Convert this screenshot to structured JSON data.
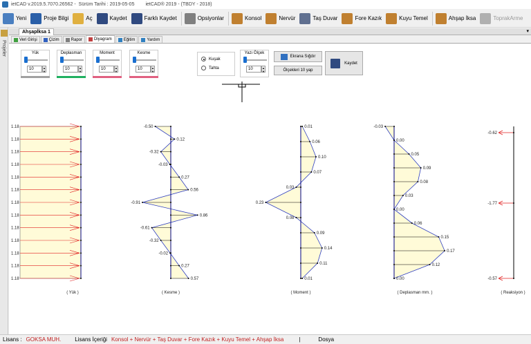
{
  "title": {
    "app_version": "ietCAD v.2019.5.7070.26562 -",
    "release_date": "Sürüm Tarihi : 2019-05-05",
    "product": "ietCAD® 2019 - (TBDY - 2018)"
  },
  "toolbar": [
    {
      "label": "Yeni",
      "icon": "new-file-icon",
      "color": "#4a7fc0"
    },
    {
      "label": "Proje Bilgi",
      "icon": "info-icon",
      "color": "#2a5fa8"
    },
    {
      "label": "Aç",
      "icon": "open-folder-icon",
      "color": "#e0b040"
    },
    {
      "label": "Kaydet",
      "icon": "save-icon",
      "color": "#304a80"
    },
    {
      "label": "Farklı Kaydet",
      "icon": "save-as-icon",
      "color": "#304a80"
    },
    {
      "label": "Opsiyonlar",
      "icon": "gear-icon",
      "color": "#808080"
    },
    {
      "label": "Konsol",
      "icon": "cantilever-wall-icon",
      "color": "#c08030"
    },
    {
      "label": "Nervür",
      "icon": "ribbed-wall-icon",
      "color": "#c08030"
    },
    {
      "label": "Taş Duvar",
      "icon": "stone-wall-icon",
      "color": "#607090"
    },
    {
      "label": "Fore Kazık",
      "icon": "bored-pile-icon",
      "color": "#c08030"
    },
    {
      "label": "Kuyu Temel",
      "icon": "well-foundation-icon",
      "color": "#c08030"
    },
    {
      "label": "Ahşap İksa",
      "icon": "timber-shoring-icon",
      "color": "#c08030"
    },
    {
      "label": "ToprakArme",
      "icon": "soil-reinforcement-icon",
      "color": "#b0b0b0",
      "disabled": true
    }
  ],
  "side_panel": {
    "label": "Projeler"
  },
  "doc_tab": {
    "label": "Ahşapİksa 1",
    "chevron": "▾"
  },
  "subtabs": [
    {
      "label": "Veri Girişi",
      "color": "#40a040"
    },
    {
      "label": "Çizim",
      "color": "#3060c0"
    },
    {
      "label": "Rapor",
      "color": "#808080"
    },
    {
      "label": "Diyagram",
      "color": "#c04040",
      "active": true
    },
    {
      "label": "Eğitim",
      "color": "#3080c0"
    },
    {
      "label": "Yardım",
      "color": "#3080c0"
    }
  ],
  "sliders": [
    {
      "label": "Yük",
      "value": "10",
      "level": 0.0,
      "bar_color": "#a0a0a0"
    },
    {
      "label": "Deplasman",
      "value": "10",
      "level": 0.0,
      "bar_color": "#20b060"
    },
    {
      "label": "Moment",
      "value": "10",
      "level": 0.0,
      "bar_color": "#e06080"
    },
    {
      "label": "Kesme",
      "value": "10",
      "level": 0.0,
      "bar_color": "#e06080"
    }
  ],
  "scale": {
    "label": "Yazı Ölçek",
    "value": "10"
  },
  "radio": [
    {
      "label": "Kuşak",
      "checked": true
    },
    {
      "label": "Tahta",
      "checked": false
    }
  ],
  "buttons": {
    "fit": "Ekrana Sığdır",
    "scale10": "Ölçekleri 10 yap",
    "save": "Kaydet"
  },
  "diagram_labels": {
    "load": "( Yük )",
    "shear": "( Kesme )",
    "moment": "( Moment )",
    "displacement": "( Deplasman mm. )",
    "reaction": "( Reaksiyon )"
  },
  "load_labels": [
    "1.18",
    "1.18",
    "1.18",
    "1.18",
    "1.18",
    "1.18",
    "1.18",
    "1.18",
    "1.18",
    "1.18",
    "1.18",
    "1.18",
    "1.18"
  ],
  "shear": [
    {
      "label": "-0.50",
      "v": -0.5
    },
    {
      "label": "0.12",
      "v": 0.12
    },
    {
      "label": "-0.32",
      "v": -0.32
    },
    {
      "label": "-0.03",
      "v": -0.03
    },
    {
      "label": "0.27",
      "v": 0.27
    },
    {
      "label": "0.56",
      "v": 0.56
    },
    {
      "label": "-0.91",
      "v": -0.91
    },
    {
      "label": "0.86",
      "v": 0.86
    },
    {
      "label": "-0.61",
      "v": -0.61
    },
    {
      "label": "-0.32",
      "v": -0.32
    },
    {
      "label": "-0.02",
      "v": -0.02
    },
    {
      "label": "0.27",
      "v": 0.27
    },
    {
      "label": "0.57",
      "v": 0.57
    }
  ],
  "moment": [
    {
      "label": "0.01",
      "v": 0.01
    },
    {
      "label": "0.06",
      "v": 0.06
    },
    {
      "label": "0.10",
      "v": 0.1
    },
    {
      "label": "0.07",
      "v": 0.07
    },
    {
      "label": "0.03",
      "v": -0.03
    },
    {
      "label": "0.23",
      "v": -0.23
    },
    {
      "label": "0.08",
      "v": -0.03
    },
    {
      "label": "0.09",
      "v": 0.09
    },
    {
      "label": "0.14",
      "v": 0.14
    },
    {
      "label": "0.11",
      "v": 0.11
    },
    {
      "label": "0.01",
      "v": 0.01
    }
  ],
  "displacement": [
    {
      "label": "-0.03",
      "v": -0.03
    },
    {
      "label": "0.00",
      "v": 0.0
    },
    {
      "label": "0.05",
      "v": 0.05
    },
    {
      "label": "0.09",
      "v": 0.09
    },
    {
      "label": "0.08",
      "v": 0.08
    },
    {
      "label": "0.03",
      "v": 0.03
    },
    {
      "label": "0.00",
      "v": 0.0
    },
    {
      "label": "0.06",
      "v": 0.06
    },
    {
      "label": "0.15",
      "v": 0.15
    },
    {
      "label": "0.17",
      "v": 0.17
    },
    {
      "label": "0.12",
      "v": 0.12
    },
    {
      "label": "0.00",
      "v": 0.0
    }
  ],
  "reaction": [
    "-0.62",
    "-1.77",
    "-0.57"
  ],
  "status": {
    "license_label": "Lisans :",
    "license_value": "GOKSA MUH.",
    "content_label": "Lisans İçeriği",
    "content_value": "Konsol + Nervür + Taş Duvar + Fore Kazık + Kuyu Temel + Ahşap İksa",
    "sep": "|",
    "unit": "Dosya"
  },
  "colors": {
    "fill": "#fffbd8",
    "load_arrow": "#e02020",
    "outline": "#3040c0",
    "axis": "#000080"
  }
}
